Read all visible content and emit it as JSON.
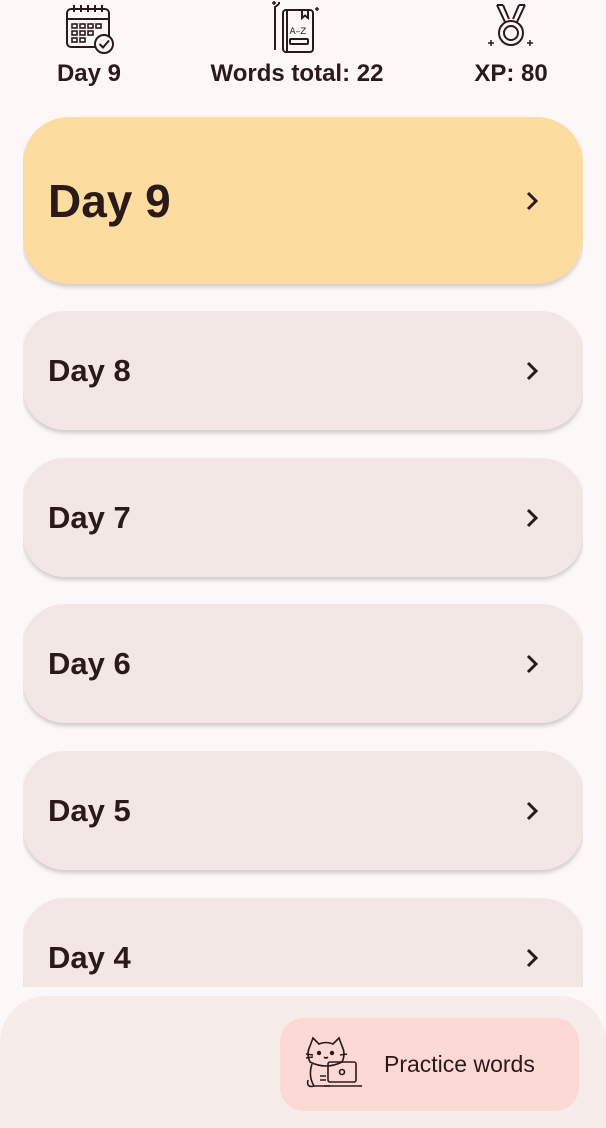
{
  "stats": {
    "day": {
      "icon": "calendar-check-icon",
      "label": "Day 9"
    },
    "words": {
      "icon": "dictionary-book-icon",
      "label": "Words total: 22"
    },
    "xp": {
      "icon": "medal-icon",
      "label": "XP: 80"
    }
  },
  "days": [
    {
      "label": "Day 9",
      "current": true
    },
    {
      "label": "Day 8",
      "current": false
    },
    {
      "label": "Day 7",
      "current": false
    },
    {
      "label": "Day 6",
      "current": false
    },
    {
      "label": "Day 5",
      "current": false
    },
    {
      "label": "Day 4",
      "current": false
    }
  ],
  "practice": {
    "label": "Practice words",
    "icon": "cat-laptop-icon"
  },
  "colors": {
    "background": "#fdf8f7",
    "current_day_card": "#fcdc9f",
    "day_card": "#f2e7e5",
    "practice_button": "#fdd9d5",
    "text": "#2b1a1a"
  }
}
